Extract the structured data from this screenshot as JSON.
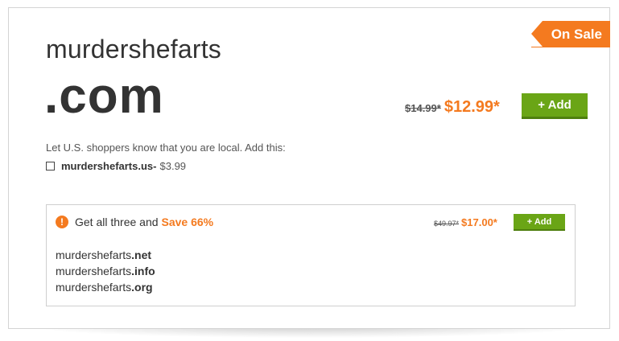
{
  "badge": "On Sale",
  "domain": {
    "name": "murdershefarts",
    "tld": ".com",
    "old_price": "$14.99*",
    "new_price": "$12.99*",
    "add_label": "+ Add"
  },
  "local_offer": {
    "text": "Let U.S. shoppers know that you are local. Add this:",
    "domain": "murdershefarts.us",
    "separator": " -",
    "price": "$3.99"
  },
  "bundle": {
    "text": "Get all three and",
    "save": "Save 66%",
    "old_price": "$49.97*",
    "new_price": "$17.00*",
    "add_label": "+ Add",
    "items": [
      {
        "base": "murdershefarts",
        "ext": ".net"
      },
      {
        "base": "murdershefarts",
        "ext": ".info"
      },
      {
        "base": "murdershefarts",
        "ext": ".org"
      }
    ]
  },
  "colors": {
    "accent": "#f47a1f",
    "button": "#6aa516"
  },
  "icons": {
    "bundle_alert": "exclamation-circle-icon"
  }
}
